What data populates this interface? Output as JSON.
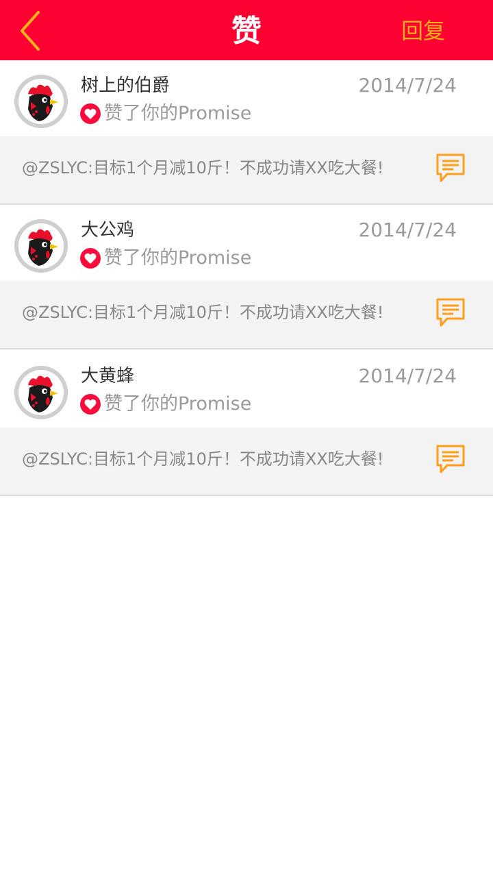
{
  "header": {
    "title": "赞",
    "reply_label": "回复",
    "colors": {
      "bar": "#ff0033",
      "accent": "#ffb21a"
    }
  },
  "items": [
    {
      "name": "树上的伯爵",
      "date": "2014/7/24",
      "like_text": "赞了你的Promise",
      "quote": "@ZSLYC:目标1个月减10斤！不成功请XX吃大餐!"
    },
    {
      "name": "大公鸡",
      "date": "2014/7/24",
      "like_text": "赞了你的Promise",
      "quote": "@ZSLYC:目标1个月减10斤！不成功请XX吃大餐!"
    },
    {
      "name": "大黄蜂",
      "date": "2014/7/24",
      "like_text": "赞了你的Promise",
      "quote": "@ZSLYC:目标1个月减10斤！不成功请XX吃大餐!"
    }
  ],
  "icons": {
    "back": "chevron-left-icon",
    "avatar": "rooster-avatar",
    "like": "heart-icon",
    "comment": "comment-icon"
  }
}
